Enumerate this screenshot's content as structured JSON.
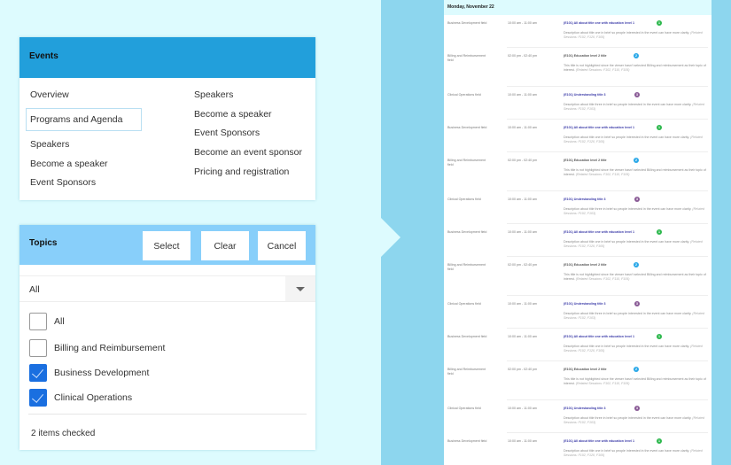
{
  "events": {
    "title": "Events",
    "col1": [
      "Overview",
      "Programs and Agenda",
      "Speakers",
      "Become a speaker",
      "Event Sponsors"
    ],
    "col2": [
      "Speakers",
      "Become a speaker",
      "Event Sponsors",
      "Become an event sponsor",
      "Pricing and registration"
    ]
  },
  "topics": {
    "title": "Topics",
    "select": "Select",
    "clear": "Clear",
    "cancel": "Cancel",
    "dropdown_value": "All",
    "options": [
      {
        "label": "All",
        "checked": false
      },
      {
        "label": "Billing and Reimbursement",
        "checked": false
      },
      {
        "label": "Business Development",
        "checked": true
      },
      {
        "label": "Clinical Operations",
        "checked": true
      }
    ],
    "count": "2 items checked"
  },
  "schedule": {
    "day": "Monday, November 22",
    "templates": [
      {
        "field": "Business Development field",
        "time": "10:00 am - 11:00 am",
        "title": "(E101) All about title one with education level 1",
        "badge": "1",
        "badge_color": "#2db84d",
        "desc": "Description about title one in brief so people interested in the event can have more clarity.",
        "related": "(Related Sessions: F102, F120, F105)",
        "dim": false,
        "h": 37
      },
      {
        "field": "Billing and Reimbursement field",
        "time": "02:00 pm - 02:40 pm",
        "title": "(E101) Education level 2 title",
        "badge": "2",
        "badge_color": "#2aa8e8",
        "desc": "This title is not highlighted since the viewer hasn't selected Billing and reimbursement as their topic of interest.",
        "related": "(Related Sessions: F102, F110, F105)",
        "dim": true,
        "h": 44
      },
      {
        "field": "Clinical Operations field",
        "time": "10:00 am - 11:00 am",
        "title": "(E101) Understanding title 3",
        "badge": "3",
        "badge_color": "#8a5b96",
        "desc": "Description about title three in brief so people interested in the event can have more clarity.",
        "related": "(Related Sessions: F102, F103)",
        "dim": false,
        "h": 37
      }
    ],
    "order": [
      0,
      1,
      2,
      0,
      1,
      2,
      0,
      1,
      2,
      0,
      1,
      2,
      0
    ]
  }
}
